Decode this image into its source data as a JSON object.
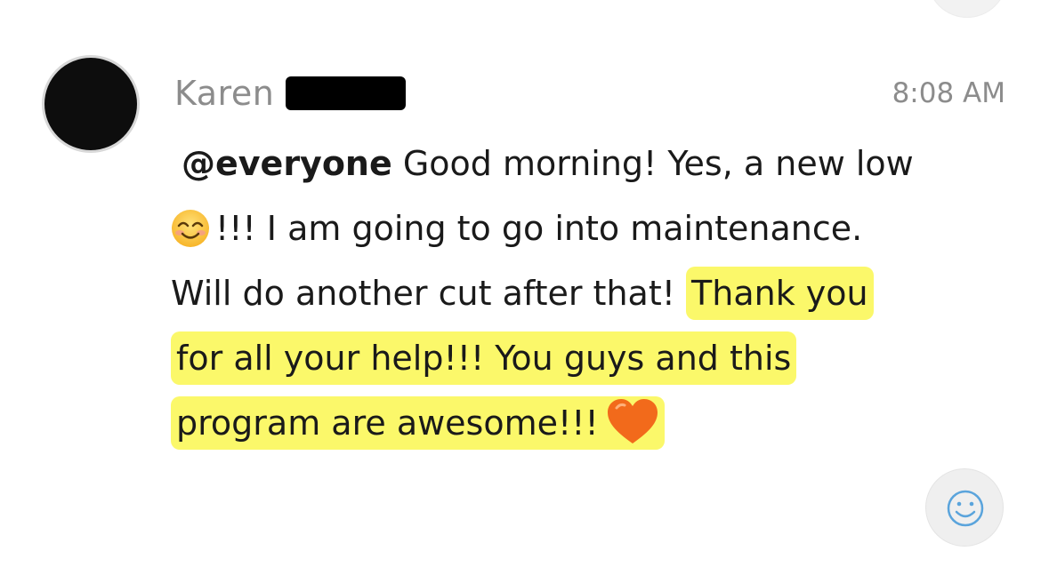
{
  "message": {
    "sender_name": "Karen",
    "timestamp": "8:08 AM",
    "mention": "@everyone",
    "lines": {
      "line1_text": " Good morning! Yes, a new low",
      "line2_text": "!!! I am going to go into maintenance.",
      "line3_plain": "Will do another cut after that! ",
      "line3_highlight": "Thank you",
      "line4_highlight": "for all your help!!! You guys and this",
      "line5_highlight": "program are awesome!!!"
    },
    "emojis": {
      "line2_leading": "smiling-face-icon",
      "line5_trailing": "orange-heart-icon"
    }
  },
  "reaction_button": {
    "icon": "smiley-add-reaction-icon"
  },
  "colors": {
    "highlight": "#fbf86a",
    "meta_text": "#8c8c8c",
    "body_text": "#1a1a1a",
    "reaction_icon": "#5aa4dc",
    "heart": "#f26a1b"
  }
}
